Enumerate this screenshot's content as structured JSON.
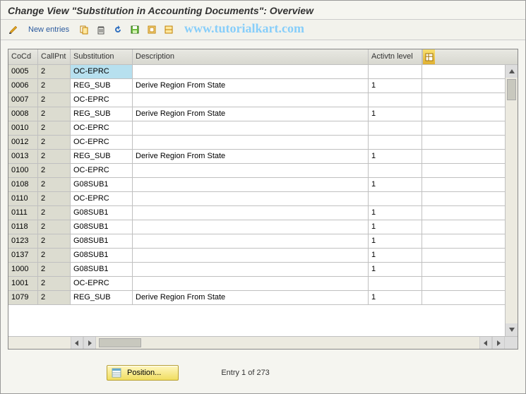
{
  "title": "Change View \"Substitution in Accounting Documents\": Overview",
  "toolbar": {
    "new_entries_label": "New entries"
  },
  "watermark": "www.tutorialkart.com",
  "grid": {
    "headers": {
      "cocd": "CoCd",
      "callpnt": "CallPnt",
      "substitution": "Substitution",
      "description": "Description",
      "activation": "Activtn level"
    },
    "rows": [
      {
        "cocd": "0005",
        "callpnt": "2",
        "sub": "OC-EPRC",
        "desc": "",
        "act": "",
        "selected": true
      },
      {
        "cocd": "0006",
        "callpnt": "2",
        "sub": "REG_SUB",
        "desc": "Derive Region From State",
        "act": "1"
      },
      {
        "cocd": "0007",
        "callpnt": "2",
        "sub": "OC-EPRC",
        "desc": "",
        "act": ""
      },
      {
        "cocd": "0008",
        "callpnt": "2",
        "sub": "REG_SUB",
        "desc": "Derive Region From State",
        "act": "1"
      },
      {
        "cocd": "0010",
        "callpnt": "2",
        "sub": "OC-EPRC",
        "desc": "",
        "act": ""
      },
      {
        "cocd": "0012",
        "callpnt": "2",
        "sub": "OC-EPRC",
        "desc": "",
        "act": ""
      },
      {
        "cocd": "0013",
        "callpnt": "2",
        "sub": "REG_SUB",
        "desc": "Derive Region From State",
        "act": "1"
      },
      {
        "cocd": "0100",
        "callpnt": "2",
        "sub": "OC-EPRC",
        "desc": "",
        "act": ""
      },
      {
        "cocd": "0108",
        "callpnt": "2",
        "sub": "G08SUB1",
        "desc": "",
        "act": "1"
      },
      {
        "cocd": "0110",
        "callpnt": "2",
        "sub": "OC-EPRC",
        "desc": "",
        "act": ""
      },
      {
        "cocd": "0111",
        "callpnt": "2",
        "sub": "G08SUB1",
        "desc": "",
        "act": "1"
      },
      {
        "cocd": "0118",
        "callpnt": "2",
        "sub": "G08SUB1",
        "desc": "",
        "act": "1"
      },
      {
        "cocd": "0123",
        "callpnt": "2",
        "sub": "G08SUB1",
        "desc": "",
        "act": "1"
      },
      {
        "cocd": "0137",
        "callpnt": "2",
        "sub": "G08SUB1",
        "desc": "",
        "act": "1"
      },
      {
        "cocd": "1000",
        "callpnt": "2",
        "sub": "G08SUB1",
        "desc": "",
        "act": "1"
      },
      {
        "cocd": "1001",
        "callpnt": "2",
        "sub": "OC-EPRC",
        "desc": "",
        "act": ""
      },
      {
        "cocd": "1079",
        "callpnt": "2",
        "sub": "REG_SUB",
        "desc": "Derive Region From State",
        "act": "1"
      }
    ]
  },
  "footer": {
    "position_label": "Position...",
    "entry_info": "Entry 1 of 273"
  }
}
